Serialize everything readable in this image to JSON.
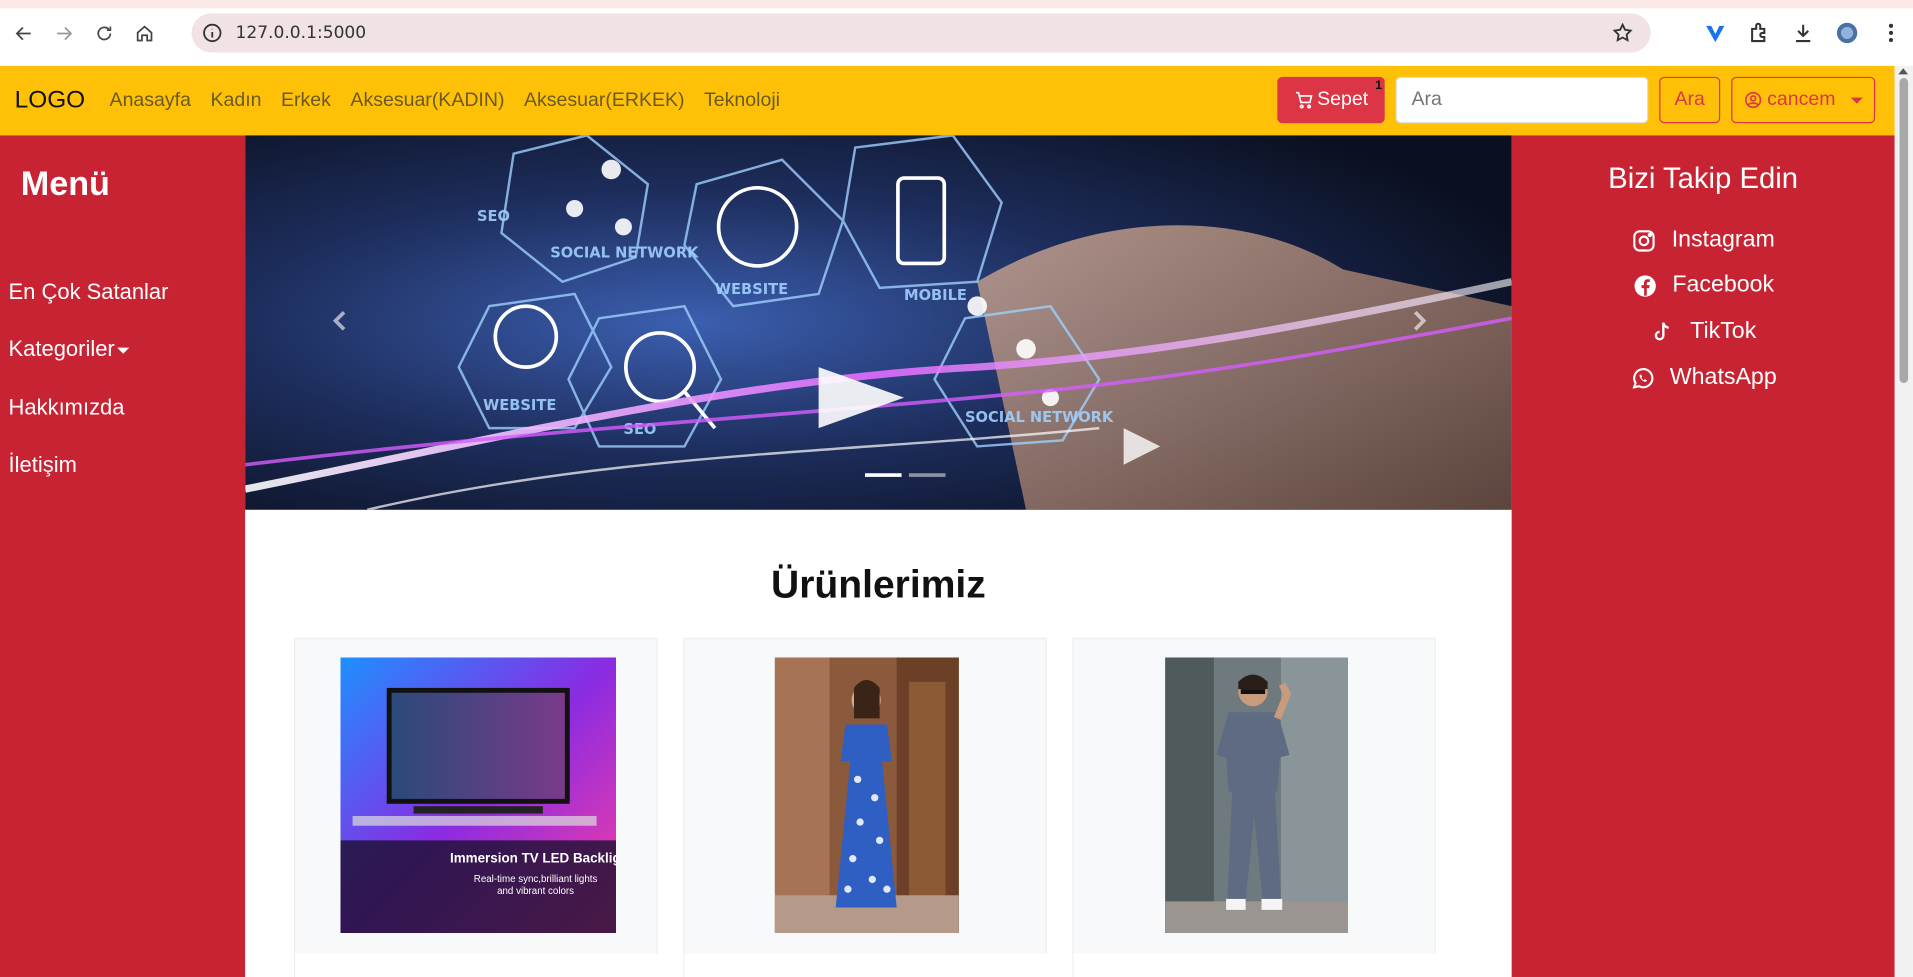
{
  "browser": {
    "url": "127.0.0.1:5000"
  },
  "navbar": {
    "brand": "LOGO",
    "links": [
      "Anasayfa",
      "Kadın",
      "Erkek",
      "Aksesuar(KADIN)",
      "Aksesuar(ERKEK)",
      "Teknoloji"
    ],
    "cart_label": "Sepet",
    "cart_count": "1",
    "search_placeholder": "Ara",
    "search_button": "Ara",
    "user_name": "cancem"
  },
  "left_menu": {
    "title": "Menü",
    "items": [
      "En Çok Satanlar",
      "Kategoriler",
      "Hakkımızda",
      "İletişim"
    ]
  },
  "right_panel": {
    "title": "Bizi Takip Edin",
    "socials": [
      {
        "label": "Instagram",
        "icon": "instagram-icon"
      },
      {
        "label": "Facebook",
        "icon": "facebook-icon"
      },
      {
        "label": "TikTok",
        "icon": "tiktok-icon"
      },
      {
        "label": "WhatsApp",
        "icon": "whatsapp-icon"
      }
    ]
  },
  "hero": {
    "slide_count": 2,
    "active_slide": 1,
    "labels": [
      "SEO",
      "SOCIAL NETWORK",
      "WEBSITE",
      "MOBILE",
      "WEBSITE",
      "SEO",
      "SOCIAL NETWORK"
    ]
  },
  "products": {
    "title": "Ürünlerimiz",
    "items": [
      {
        "image_title": "Immersion TV LED Backlight",
        "image_subtitle_1": "Real-time sync,brilliant lights",
        "image_subtitle_2": "and vibrant colors"
      },
      {
        "image_title": ""
      },
      {
        "image_title": ""
      }
    ]
  },
  "colors": {
    "navbar": "#ffc107",
    "sidebar": "#c82333",
    "danger": "#dc3545"
  }
}
